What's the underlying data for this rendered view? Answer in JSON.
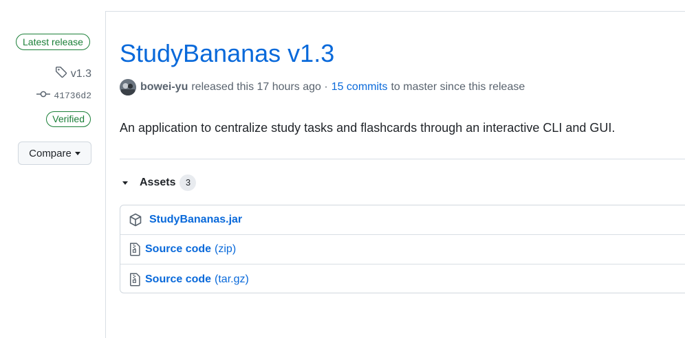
{
  "sidebar": {
    "latest_badge": "Latest release",
    "tag": "v1.3",
    "commit": "41736d2",
    "verified": "Verified",
    "compare_label": "Compare"
  },
  "release": {
    "title": "StudyBananas v1.3",
    "author": "bowei-yu",
    "released_text": "released this 17 hours ago ·",
    "commits_link": "15 commits",
    "commits_suffix": "to master since this release",
    "description": "An application to centralize study tasks and flashcards through an interactive CLI and GUI."
  },
  "assets": {
    "heading": "Assets",
    "count": "3",
    "items": [
      {
        "name": "StudyBananas.jar",
        "ext": "",
        "icon": "package-icon"
      },
      {
        "name": "Source code",
        "ext": "(zip)",
        "icon": "file-zip-icon"
      },
      {
        "name": "Source code",
        "ext": "(tar.gz)",
        "icon": "file-zip-icon"
      }
    ]
  },
  "colors": {
    "link": "#0969da",
    "success": "#1a7f37",
    "muted": "#59636e",
    "border": "#d0d7de"
  }
}
